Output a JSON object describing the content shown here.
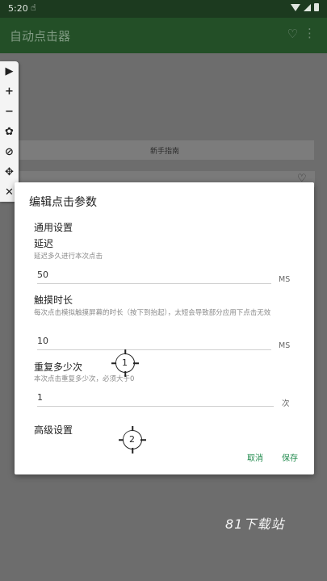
{
  "status": {
    "time": "5:20",
    "touch_icon": "touch-app-icon"
  },
  "app": {
    "title": "自动点击器"
  },
  "panel": {
    "icons": [
      "play-icon",
      "plus-icon",
      "minus-icon",
      "gear-icon",
      "hide-eye-icon",
      "move-icon",
      "close-icon"
    ],
    "glyphs": [
      "▶",
      "+",
      "−",
      "✿",
      "⊘",
      "✥",
      "✕"
    ]
  },
  "background": {
    "guide_label": "新手指南"
  },
  "dialog": {
    "title": "编辑点击参数",
    "general_section": "通用设置",
    "delay": {
      "label": "延迟",
      "hint": "延迟多久进行本次点击",
      "value": "50",
      "unit": "MS"
    },
    "touch_duration": {
      "label": "触摸时长",
      "hint": "每次点击模拟触摸屏幕的时长（按下到抬起），太短会导致部分应用下点击无效",
      "value": "10",
      "unit": "MS"
    },
    "repeat": {
      "label": "重复多少次",
      "hint": "本次点击重复多少次，必须大于0",
      "value": "1",
      "unit": "次"
    },
    "advanced_section": "高级设置",
    "cancel": "取消",
    "save": "保存"
  },
  "targets": [
    "1",
    "2"
  ],
  "watermark": "81下载站",
  "colors": {
    "accent": "#1f8a4c",
    "appbar": "#234f27"
  }
}
